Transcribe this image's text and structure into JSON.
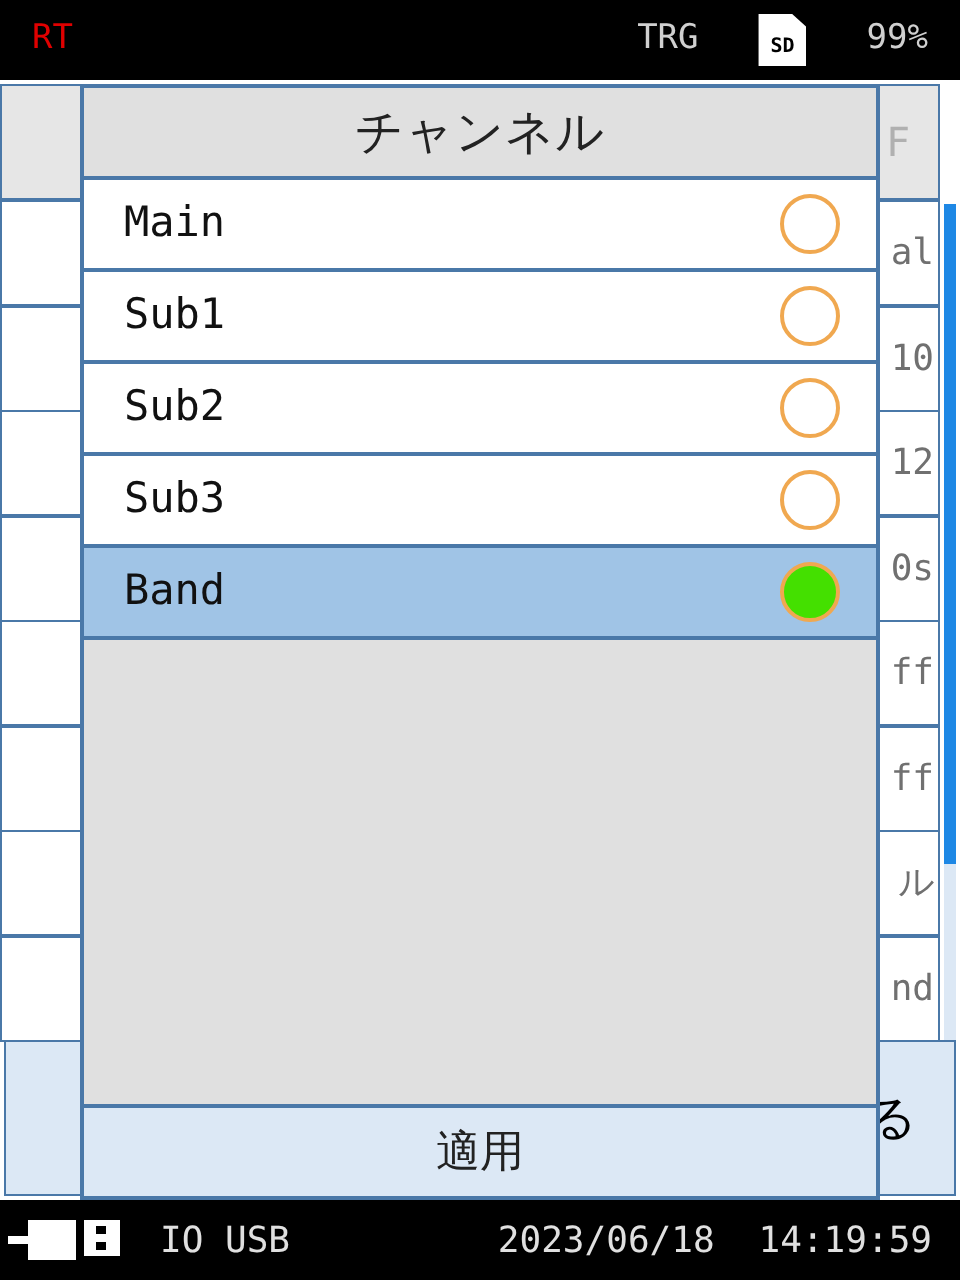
{
  "status_bar": {
    "mode": "RT",
    "trigger": "TRG",
    "storage": "SD",
    "battery": "99%"
  },
  "background": {
    "header_value": "F",
    "row_values": [
      "al",
      "10",
      "12",
      "0s",
      "ff",
      "ff",
      "ル",
      "nd"
    ],
    "footer_right": "る"
  },
  "dialog": {
    "title": "チャンネル",
    "options": [
      {
        "label": "Main",
        "selected": false
      },
      {
        "label": "Sub1",
        "selected": false
      },
      {
        "label": "Sub2",
        "selected": false
      },
      {
        "label": "Sub3",
        "selected": false
      },
      {
        "label": "Band",
        "selected": true
      }
    ],
    "apply_button": "適用"
  },
  "bottom_bar": {
    "interface": "IO USB",
    "date": "2023/06/18",
    "time": "14:19:59"
  }
}
